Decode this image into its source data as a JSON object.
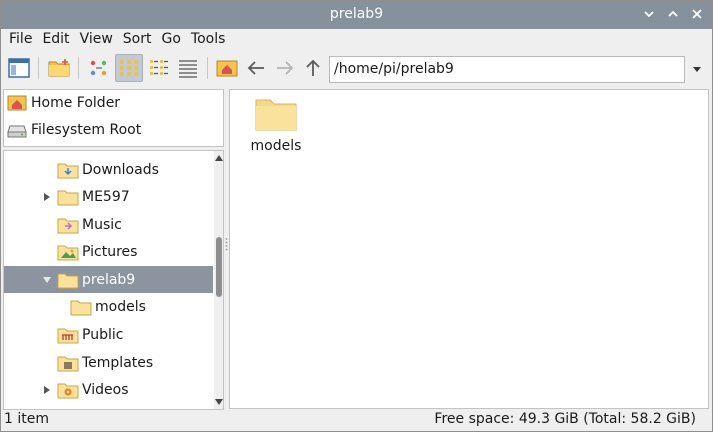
{
  "window": {
    "title": "prelab9"
  },
  "menu": [
    "File",
    "Edit",
    "View",
    "Sort",
    "Go",
    "Tools"
  ],
  "toolbar": {
    "path": "/home/pi/prelab9"
  },
  "places": [
    {
      "label": "Home Folder",
      "icon": "home-icon"
    },
    {
      "label": "Filesystem Root",
      "icon": "drive-icon"
    }
  ],
  "tree": [
    {
      "label": "Downloads",
      "icon": "folder-downloads-icon",
      "expander": ""
    },
    {
      "label": "ME597",
      "icon": "folder-icon",
      "expander": "collapsed"
    },
    {
      "label": "Music",
      "icon": "folder-music-icon",
      "expander": ""
    },
    {
      "label": "Pictures",
      "icon": "folder-pictures-icon",
      "expander": ""
    },
    {
      "label": "prelab9",
      "icon": "folder-icon",
      "expander": "expanded",
      "selected": true
    },
    {
      "label": "models",
      "icon": "folder-icon",
      "expander": "",
      "indent": 1
    },
    {
      "label": "Public",
      "icon": "folder-public-icon",
      "expander": ""
    },
    {
      "label": "Templates",
      "icon": "folder-templates-icon",
      "expander": ""
    },
    {
      "label": "Videos",
      "icon": "folder-videos-icon",
      "expander": "collapsed"
    }
  ],
  "files": [
    {
      "name": "models",
      "icon": "folder-icon"
    }
  ],
  "status": {
    "left": "1 item",
    "right": "Free space: 49.3 GiB (Total: 58.2 GiB)"
  },
  "colors": {
    "titlebar": "#87919c",
    "selection": "#8c959f",
    "folder": "#fbe29c"
  }
}
